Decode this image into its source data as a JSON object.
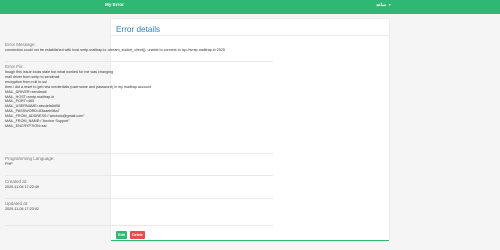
{
  "navbar": {
    "brand": "My Error",
    "user": "ساعد",
    "caret": "▼"
  },
  "card": {
    "title": "Error details"
  },
  "fields": [
    {
      "label": "Error Message:",
      "lines": [
        "connection could not be established with host smtp.mailtrap.io :stream_socket_client(): unable to connect to tcp://smtp.mailtrap.io:2525"
      ]
    },
    {
      "label": "Error Fix:",
      "lines": [
        "Itough this issue looks stale but what worked for me was changing",
        "mail driver from smtp to sendmail",
        "encryption from null to ssl",
        "then i did a reset to get new credentials (username and password) in my mailtrap account",
        "",
        "MAIL_DRIVER=sendmail",
        "MAIL_HOST=smtp.mailtrap.io",
        "MAIL_PORT=465",
        "MAIL_USERNAME=abcdefa8d98",
        "MAIL_PASSWORD=83aaeb98a7",
        "MAIL_FROM_ADDRESS=\"ancholo@gmail.com\"",
        "MAIL_FROM_NAME=\"Anchor Support\"",
        "MAIL_ENCRYPTION=ssl"
      ]
    },
    {
      "label": "Programming Language:",
      "lines": [
        "PHP"
      ]
    },
    {
      "label": "Created at:",
      "lines": [
        "2020-11-04 17:22:49"
      ]
    },
    {
      "label": "Updated at:",
      "lines": [
        "2020-11-04 17:23:02"
      ]
    }
  ],
  "buttons": {
    "edit": "Edit",
    "delete": "Delete"
  },
  "colors": {
    "brand_green": "#2fb774",
    "title_blue": "#2e7fc5",
    "danger": "#e0504c"
  }
}
